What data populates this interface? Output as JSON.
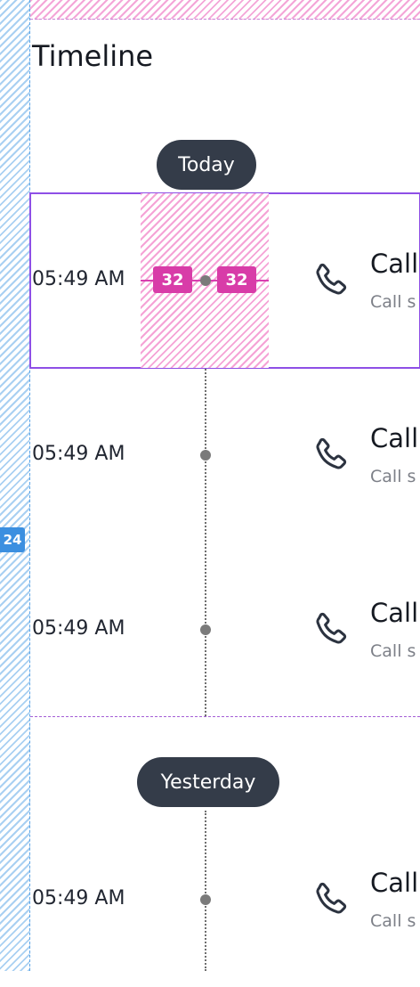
{
  "page": {
    "title": "Timeline"
  },
  "overlay": {
    "left_gap": "24",
    "center_gap_left": "32",
    "center_gap_right": "32"
  },
  "groups": [
    {
      "label": "Today",
      "items": [
        {
          "time": "05:49 AM",
          "title": "Call",
          "subtitle": "Call s",
          "icon": "phone-icon"
        },
        {
          "time": "05:49 AM",
          "title": "Call",
          "subtitle": "Call s",
          "icon": "phone-icon"
        },
        {
          "time": "05:49 AM",
          "title": "Call",
          "subtitle": "Call s",
          "icon": "phone-icon"
        }
      ]
    },
    {
      "label": "Yesterday",
      "items": [
        {
          "time": "05:49 AM",
          "title": "Call",
          "subtitle": "Call s",
          "icon": "phone-icon"
        }
      ]
    }
  ],
  "colors": {
    "chip_bg": "#343c49",
    "selection_outline": "#8e4fe6",
    "spacing_badge": "#d83ca8",
    "spacing_left": "#3b8fe0"
  }
}
